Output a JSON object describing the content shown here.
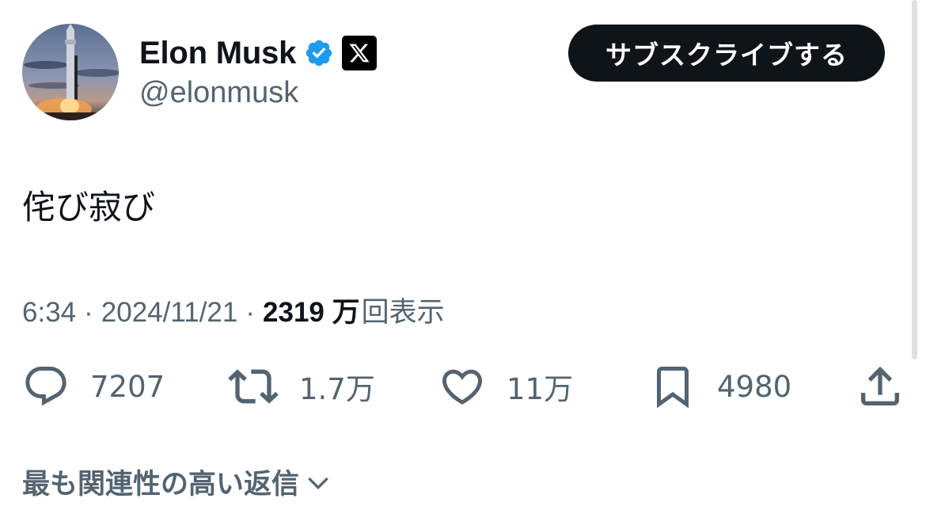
{
  "author": {
    "name": "Elon Musk",
    "handle": "@elonmusk",
    "verified_icon": "verified-badge-icon",
    "affiliation_icon": "x-logo-icon"
  },
  "subscribe_label": "サブスクライブする",
  "tweet": {
    "text": "侘び寂び"
  },
  "meta": {
    "time": "6:34",
    "separator": "·",
    "date": "2024/11/21",
    "views": "2319 万",
    "views_label": "回表示"
  },
  "actions": {
    "replies": "7207",
    "retweets": "1.7万",
    "likes": "11万",
    "bookmarks": "4980"
  },
  "replies_sort_label": "最も関連性の高い返信",
  "colors": {
    "text_primary": "#0f1419",
    "text_secondary": "#536471",
    "verified_blue": "#1d9bf0",
    "button_bg": "#0f1419"
  }
}
